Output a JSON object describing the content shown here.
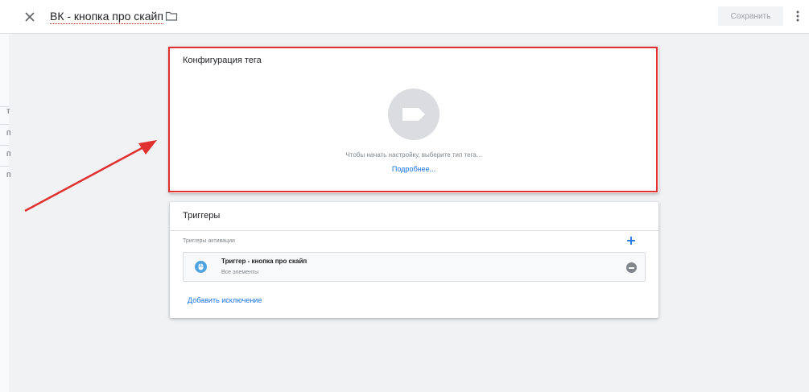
{
  "header": {
    "tag_name": "ВК - кнопка про скайп",
    "save_label": "Сохранить"
  },
  "left_strip": {
    "fragments": [
      "т",
      "п",
      "п",
      "п"
    ]
  },
  "tag_config": {
    "title": "Конфигурация тега",
    "hint": "Чтобы начать настройку, выберите тип тега...",
    "learn_more": "Подробнее..."
  },
  "triggers": {
    "title": "Триггеры",
    "firing_label": "Триггеры активации",
    "items": [
      {
        "name": "Триггер - кнопка про скайп",
        "subtitle": "Все элементы"
      }
    ],
    "add_exception": "Добавить исключение"
  },
  "colors": {
    "accent": "#1a73e8",
    "highlight_frame": "#e03030",
    "trigger_icon": "#4fa3e0"
  },
  "icons": {
    "close": "close-icon",
    "folder": "folder-icon",
    "more": "more-vert-icon",
    "tag": "tag-icon",
    "plus": "plus-icon",
    "trigger": "click-trigger-icon",
    "remove": "remove-circle-icon"
  }
}
